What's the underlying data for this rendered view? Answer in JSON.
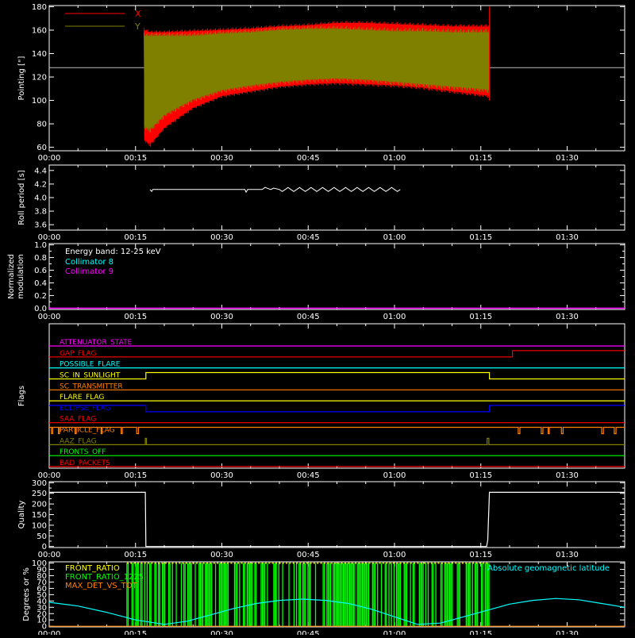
{
  "colors": {
    "background": "#000000",
    "axes": "#ffffff",
    "x_series": "#ff0000",
    "y_series": "#808000",
    "cyan": "#00ffff",
    "magenta": "#ff00ff",
    "green": "#00ff00",
    "orange": "#ff8000",
    "yellow": "#ffff00",
    "blue": "#0000ff"
  },
  "chart_data": [
    {
      "type": "line",
      "ylabel": "Pointing [\"]",
      "ylim": [
        57,
        181
      ],
      "yticks": [
        60,
        80,
        100,
        120,
        140,
        160,
        180
      ],
      "xticks": [
        "00:00",
        "00:15",
        "00:30",
        "00:45",
        "01:00",
        "01:15",
        "01:30"
      ],
      "reference_line": 128,
      "legend": [
        {
          "name": "X",
          "color": "#ff0000"
        },
        {
          "name": "Y",
          "color": "#808000"
        }
      ],
      "envelope_time_min": [
        16.5,
        17.5,
        20,
        25,
        30,
        35,
        40,
        45,
        50,
        55,
        60,
        65,
        70,
        75,
        76.5
      ],
      "series": [
        {
          "name": "X",
          "upper": [
            162,
            160,
            160,
            161,
            162,
            163,
            165,
            166,
            168,
            168,
            167,
            166,
            165,
            165,
            165
          ],
          "lower": [
            65,
            60,
            75,
            92,
            102,
            106,
            110,
            112,
            113,
            112,
            111,
            109,
            106,
            103,
            102
          ]
        },
        {
          "name": "Y",
          "upper": [
            158,
            158,
            158,
            158,
            160,
            161,
            163,
            164,
            164,
            163,
            162,
            162,
            161,
            161,
            161
          ],
          "lower": [
            75,
            72,
            85,
            98,
            106,
            110,
            113,
            115,
            116,
            115,
            113,
            111,
            109,
            107,
            106
          ]
        }
      ]
    },
    {
      "type": "line",
      "ylabel": "Roll period [s]",
      "ylim": [
        3.52,
        4.48
      ],
      "yticks": [
        3.6,
        3.8,
        4.0,
        4.2,
        4.4
      ],
      "xticks": [
        "00:00",
        "00:15",
        "00:30",
        "00:45",
        "01:00",
        "01:15",
        "01:30"
      ],
      "series": [
        {
          "name": "roll",
          "x_min": [
            17.5,
            17.8,
            18,
            34,
            34.2,
            34.5,
            37,
            37.5,
            38.5,
            39,
            40,
            40.5,
            41,
            41.5,
            42,
            42.5,
            43,
            43.5,
            44,
            44.5,
            45,
            45.5,
            46,
            46.5,
            47,
            47.5,
            48,
            48.5,
            49,
            49.5,
            50,
            50.5,
            51,
            51.5,
            52,
            52.5,
            53,
            53.5,
            54,
            54.5,
            55,
            55.5,
            56,
            56.5,
            57,
            57.5,
            58,
            58.5,
            59,
            59.5,
            60,
            60.5,
            61
          ],
          "values": [
            4.12,
            4.09,
            4.12,
            4.12,
            4.08,
            4.12,
            4.12,
            4.15,
            4.12,
            4.14,
            4.12,
            4.09,
            4.12,
            4.15,
            4.12,
            4.09,
            4.12,
            4.15,
            4.12,
            4.09,
            4.12,
            4.15,
            4.12,
            4.09,
            4.12,
            4.15,
            4.12,
            4.09,
            4.12,
            4.15,
            4.12,
            4.09,
            4.12,
            4.15,
            4.12,
            4.09,
            4.12,
            4.15,
            4.12,
            4.09,
            4.12,
            4.15,
            4.12,
            4.09,
            4.12,
            4.15,
            4.12,
            4.09,
            4.12,
            4.15,
            4.12,
            4.09,
            4.12
          ]
        }
      ]
    },
    {
      "type": "line",
      "ylabel": "Normalized modulation",
      "ylim": [
        -0.02,
        1.02
      ],
      "yticks": [
        0.0,
        0.2,
        0.4,
        0.6,
        0.8,
        1.0
      ],
      "yticks_minor": [
        0.1,
        0.3,
        0.5,
        0.7,
        0.9
      ],
      "xticks": [
        "00:00",
        "00:15",
        "00:30",
        "00:45",
        "01:00",
        "01:15",
        "01:30"
      ],
      "annotation": "Energy band: 12-25 keV",
      "legend": [
        {
          "name": "Collimator 8",
          "color": "#00ffff"
        },
        {
          "name": "Collimator 9",
          "color": "#ff00ff"
        }
      ],
      "series": [
        {
          "name": "Collimator 9",
          "x_min": [
            0,
            100
          ],
          "values": [
            0.0,
            0.0
          ]
        }
      ]
    },
    {
      "type": "line",
      "ylabel": "Flags",
      "xticks": [
        "00:00",
        "00:15",
        "00:30",
        "00:45",
        "01:00",
        "01:15",
        "01:30"
      ],
      "flags": [
        {
          "label": "ATTENUATOR_STATE",
          "color": "#ff00ff",
          "segments": [
            [
              0,
              100,
              0
            ]
          ]
        },
        {
          "label": "GAP_FLAG",
          "color": "#ff0000",
          "segments": [
            [
              0,
              80.5,
              0
            ],
            [
              80.5,
              100,
              1
            ]
          ]
        },
        {
          "label": "POSSIBLE_FLARE",
          "color": "#00ffff",
          "segments": [
            [
              0,
              100,
              0
            ]
          ]
        },
        {
          "label": "SC_IN_SUNLIGHT",
          "color": "#ffff00",
          "segments": [
            [
              0,
              16.8,
              0
            ],
            [
              16.8,
              76.5,
              1
            ],
            [
              76.5,
              100,
              0
            ]
          ]
        },
        {
          "label": "SC_TRANSMITTER",
          "color": "#ff8000",
          "segments": [
            [
              0,
              100,
              0
            ]
          ]
        },
        {
          "label": "FLARE_FLAG",
          "color": "#ffff00",
          "segments": [
            [
              0,
              100,
              0
            ]
          ]
        },
        {
          "label": "ECLIPSE_FLAG",
          "color": "#0000ff",
          "segments": [
            [
              0,
              16.8,
              1
            ],
            [
              16.8,
              76.5,
              0
            ],
            [
              76.5,
              100,
              1
            ]
          ]
        },
        {
          "label": "SAA_FLAG",
          "color": "#ff0000",
          "segments": [
            [
              0,
              100,
              0
            ]
          ]
        },
        {
          "label": "PARTICLE_FLAG",
          "color": "#ff8000",
          "segments": [
            [
              0,
              0.4,
              1
            ],
            [
              0.4,
              0.6,
              0
            ],
            [
              0.6,
              1.6,
              1
            ],
            [
              1.6,
              1.8,
              0
            ],
            [
              1.8,
              4.5,
              1
            ],
            [
              4.5,
              4.7,
              0
            ],
            [
              4.7,
              9.0,
              1
            ],
            [
              9.0,
              9.2,
              0
            ],
            [
              9.2,
              12.5,
              1
            ],
            [
              12.5,
              12.7,
              0
            ],
            [
              12.7,
              15.2,
              1
            ],
            [
              15.2,
              15.5,
              0
            ],
            [
              15.5,
              81.5,
              1
            ],
            [
              81.5,
              81.8,
              0
            ],
            [
              81.8,
              85.5,
              1
            ],
            [
              85.5,
              85.8,
              0
            ],
            [
              85.8,
              86.7,
              1
            ],
            [
              86.7,
              86.9,
              0
            ],
            [
              86.9,
              89.0,
              1
            ],
            [
              89.0,
              89.3,
              0
            ],
            [
              89.3,
              96.0,
              1
            ],
            [
              96.0,
              96.3,
              0
            ],
            [
              96.3,
              98.2,
              1
            ],
            [
              98.2,
              98.5,
              0
            ],
            [
              98.5,
              100,
              1
            ]
          ]
        },
        {
          "label": "AAZ_FLAG",
          "color": "#808000",
          "segments": [
            [
              0,
              16.7,
              0
            ],
            [
              16.7,
              16.9,
              1
            ],
            [
              16.9,
              76.1,
              0
            ],
            [
              76.1,
              76.4,
              1
            ],
            [
              76.4,
              100,
              0
            ]
          ]
        },
        {
          "label": "FRONTS_OFF",
          "color": "#00ff00",
          "segments": [
            [
              0,
              100,
              0
            ]
          ]
        },
        {
          "label": "BAD_PACKETS",
          "color": "#ff0000",
          "segments": [
            [
              0,
              100,
              0
            ]
          ]
        }
      ]
    },
    {
      "type": "line",
      "ylabel": "Quality",
      "ylim": [
        -5,
        305
      ],
      "yticks": [
        0,
        50,
        100,
        150,
        200,
        250,
        300
      ],
      "yticks_minor": [
        25,
        75,
        125,
        175,
        225,
        275
      ],
      "xticks": [
        "00:00",
        "00:15",
        "00:30",
        "00:45",
        "01:00",
        "01:15",
        "01:30"
      ],
      "series": [
        {
          "name": "quality",
          "x_min": [
            0,
            16.7,
            16.8,
            76.0,
            76.2,
            76.5,
            100
          ],
          "values": [
            255,
            255,
            0,
            0,
            30,
            255,
            255
          ]
        }
      ]
    },
    {
      "type": "area",
      "ylabel": "Degrees or %",
      "ylim": [
        -1,
        102
      ],
      "yticks": [
        0,
        10,
        20,
        30,
        40,
        50,
        60,
        70,
        80,
        90,
        100
      ],
      "xticks": [
        "00:00",
        "00:15",
        "00:30",
        "00:45",
        "01:00",
        "01:15",
        "01:30"
      ],
      "legend": [
        {
          "name": "FRONT_RATIO",
          "color": "#ffff00"
        },
        {
          "name": "FRONT_RATIO_1225",
          "color": "#00ff00"
        },
        {
          "name": "MAX_DET_VS_TOT",
          "color": "#ff8000"
        },
        {
          "name": "Absolute geomagnetic latitude",
          "color": "#00ffff"
        }
      ],
      "front_ratio_span_min": [
        13.5,
        76.5
      ],
      "front_ratio_value": 100,
      "series": [
        {
          "name": "Absolute geomagnetic latitude",
          "x_min": [
            0,
            5,
            10,
            15,
            20,
            24,
            28,
            32,
            36,
            40,
            44,
            48,
            52,
            56,
            60,
            64,
            68,
            72,
            76,
            80,
            84,
            88,
            92,
            96,
            100
          ],
          "values": [
            38,
            32,
            22,
            10,
            3,
            8,
            18,
            28,
            36,
            41,
            43,
            41,
            36,
            27,
            15,
            3,
            5,
            15,
            25,
            35,
            41,
            44,
            42,
            36,
            30
          ]
        }
      ]
    }
  ]
}
